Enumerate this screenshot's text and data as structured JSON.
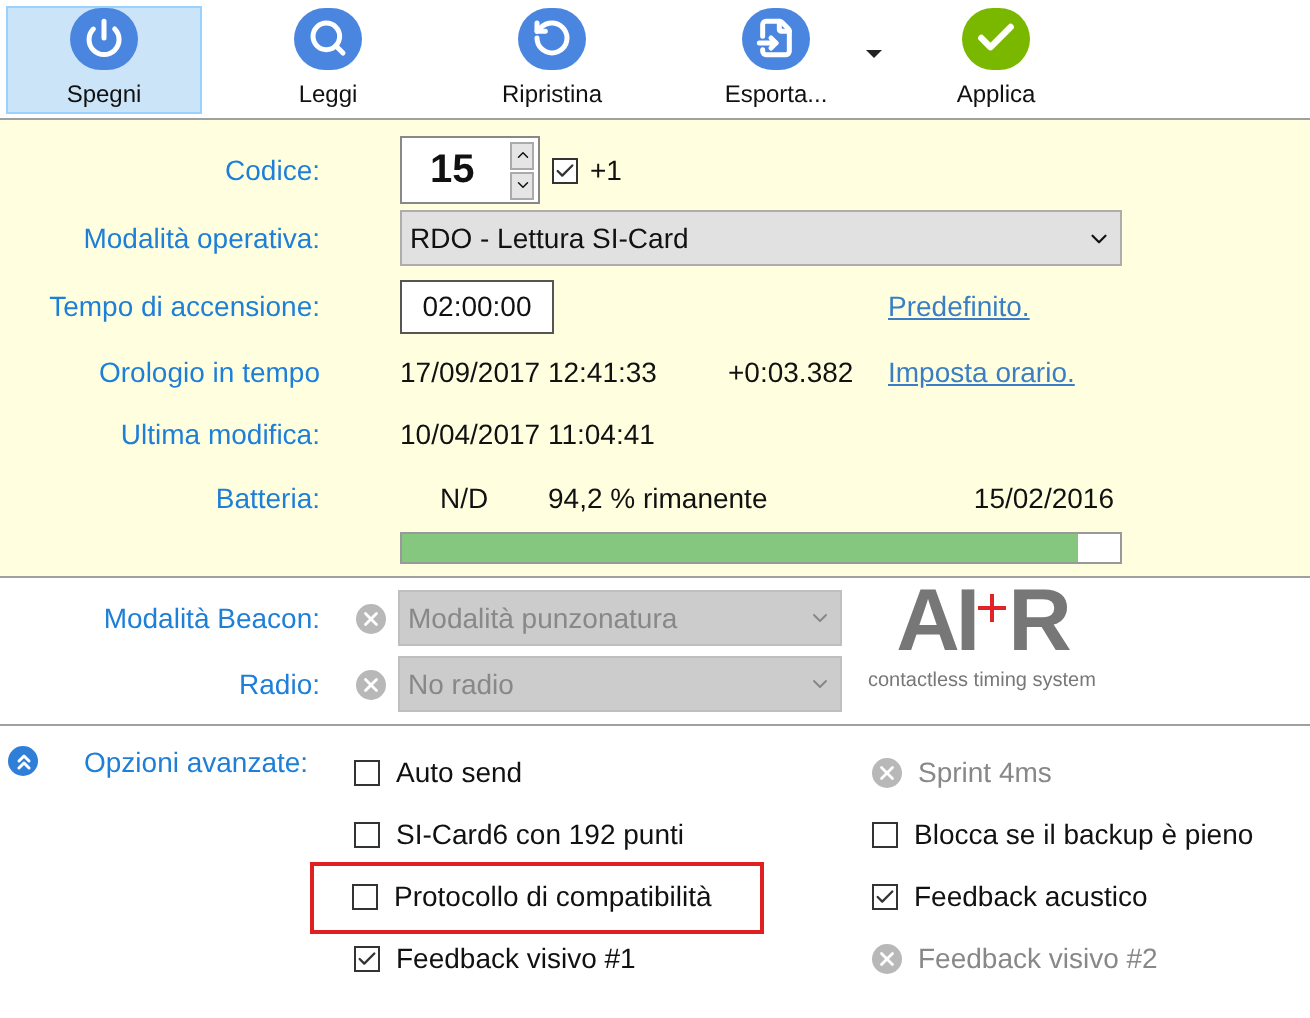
{
  "toolbar": [
    {
      "label": "Spegni",
      "kind": "power",
      "selected": true,
      "dropdown": false
    },
    {
      "label": "Leggi",
      "kind": "read",
      "selected": false,
      "dropdown": false
    },
    {
      "label": "Ripristina",
      "kind": "restore",
      "selected": false,
      "dropdown": false
    },
    {
      "label": "Esporta...",
      "kind": "export",
      "selected": false,
      "dropdown": true
    },
    {
      "label": "Applica",
      "kind": "apply",
      "selected": false,
      "dropdown": false
    }
  ],
  "station": {
    "code_label": "Codice:",
    "code": "15",
    "plus_one_checked": true,
    "plus_one_label": "+1",
    "mode_label": "Modalità operativa:",
    "mode": "RDO - Lettura SI-Card",
    "on_time_label": "Tempo di accensione:",
    "on_time": "02:00:00",
    "default_link": "Predefinito.",
    "clock_label": "Orologio in tempo",
    "clock": "17/09/2017 12:41:33",
    "clock_offset": "+0:03.382",
    "set_time_link": "Imposta orario.",
    "modified_label": "Ultima modifica:",
    "modified": "10/04/2017 11:04:41",
    "battery_label": "Batteria:",
    "battery_voltage": "N/D",
    "battery_remaining": "94,2 % rimanente",
    "battery_date": "15/02/2016",
    "level": 0.942
  },
  "beacon": {
    "label": "Modalità Beacon:",
    "value": "Modalità punzonatura",
    "disabled": true
  },
  "radio": {
    "label": "Radio:",
    "value": "No radio",
    "disabled": true
  },
  "logo": {
    "wordmark_left": "AI",
    "wordmark_right": "R",
    "tagline": "contactless timing system"
  },
  "advanced": {
    "label": "Opzioni avanzate:",
    "expanded": true,
    "options": [
      {
        "label": "Auto send",
        "kind": "checkbox",
        "checked": false,
        "highlighted": false
      },
      {
        "label": "Sprint 4ms",
        "kind": "unavailable",
        "highlighted": false
      },
      {
        "label": "SI-Card6 con 192 punti",
        "kind": "checkbox",
        "checked": false,
        "highlighted": false
      },
      {
        "label": "Blocca se il backup è pieno",
        "kind": "checkbox",
        "checked": false,
        "highlighted": false
      },
      {
        "label": "Protocollo di compatibilità",
        "kind": "checkbox",
        "checked": false,
        "highlighted": true
      },
      {
        "label": "Feedback acustico",
        "kind": "checkbox",
        "checked": true,
        "highlighted": false
      },
      {
        "label": "Feedback visivo #1",
        "kind": "checkbox",
        "checked": true,
        "highlighted": false
      },
      {
        "label": "Feedback visivo #2",
        "kind": "unavailable",
        "highlighted": false
      }
    ]
  }
}
